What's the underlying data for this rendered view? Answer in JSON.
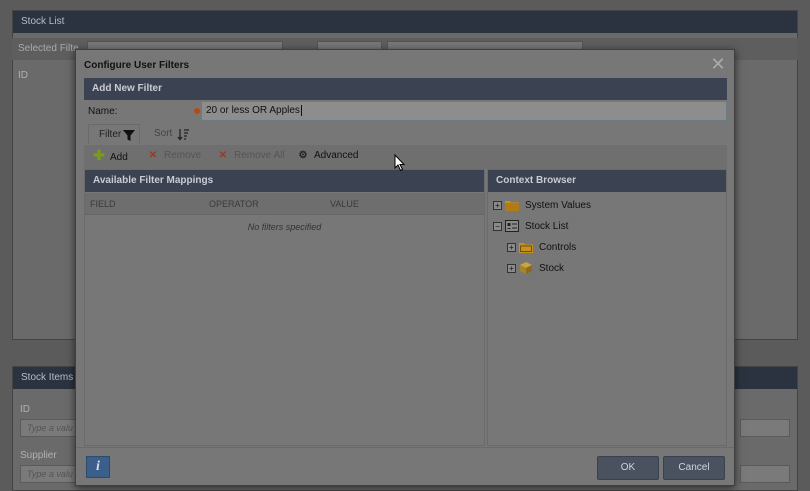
{
  "background": {
    "panel_title": "Stock List",
    "selected_filter_label": "Selected Filte",
    "id_header": "ID",
    "items_panel_title": "Stock Items",
    "id_label": "ID",
    "id_placeholder": "Type a valu",
    "supplier_label": "Supplier",
    "supplier_placeholder": "Type a valu"
  },
  "dialog": {
    "title": "Configure User Filters",
    "close_icon": "close-icon",
    "section_title": "Add New Filter",
    "name_label": "Name:",
    "name_value": "20 or less OR Apples",
    "tabs": [
      {
        "label": "Filter",
        "icon": "funnel-icon"
      },
      {
        "label": "Sort",
        "icon": "sort-icon"
      }
    ],
    "toolbar": {
      "add": "Add",
      "remove": "Remove",
      "remove_all": "Remove All",
      "advanced": "Advanced"
    },
    "mappings": {
      "title": "Available Filter Mappings",
      "columns": [
        "FIELD",
        "OPERATOR",
        "VALUE"
      ],
      "empty_text": "No filters specified"
    },
    "context_browser": {
      "title": "Context Browser",
      "tree": [
        {
          "label": "System Values",
          "toggle": "+",
          "icon": "folder-icon",
          "level": 0
        },
        {
          "label": "Stock List",
          "toggle": "−",
          "icon": "form-icon",
          "level": 0
        },
        {
          "label": "Controls",
          "toggle": "+",
          "icon": "folder-icon",
          "level": 1
        },
        {
          "label": "Stock",
          "toggle": "+",
          "icon": "cube-icon",
          "level": 1
        }
      ]
    },
    "footer": {
      "info": "i",
      "ok": "OK",
      "cancel": "Cancel"
    }
  },
  "colors": {
    "header_bg": "#3b4252",
    "required_dot": "#b44a0e",
    "add_green": "#7a9a1a",
    "remove_red": "#a0371f",
    "info_blue": "#3a5f8a",
    "folder_orange": "#c8901c"
  }
}
